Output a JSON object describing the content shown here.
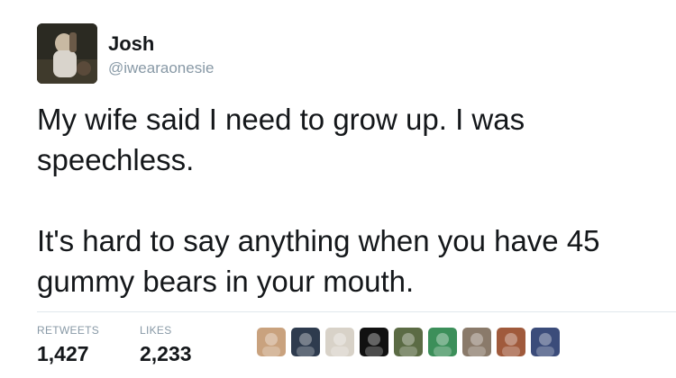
{
  "user": {
    "name": "Josh",
    "handle": "@iwearaonesie"
  },
  "tweet": {
    "paragraphs": [
      "My wife said I need to grow up. I was speechless.",
      "It's hard to say anything when you have 45 gummy bears in your mouth."
    ]
  },
  "stats": {
    "retweets_label": "RETWEETS",
    "retweets_count": "1,427",
    "likes_label": "LIKES",
    "likes_count": "2,233"
  },
  "likers": [
    {
      "color": "#c9a27e"
    },
    {
      "color": "#2e3b4e"
    },
    {
      "color": "#d8d2c8"
    },
    {
      "color": "#111111"
    },
    {
      "color": "#5b6b44"
    },
    {
      "color": "#3c8f5a"
    },
    {
      "color": "#8a7a6a"
    },
    {
      "color": "#a05a3c"
    },
    {
      "color": "#3b4c7a"
    }
  ]
}
